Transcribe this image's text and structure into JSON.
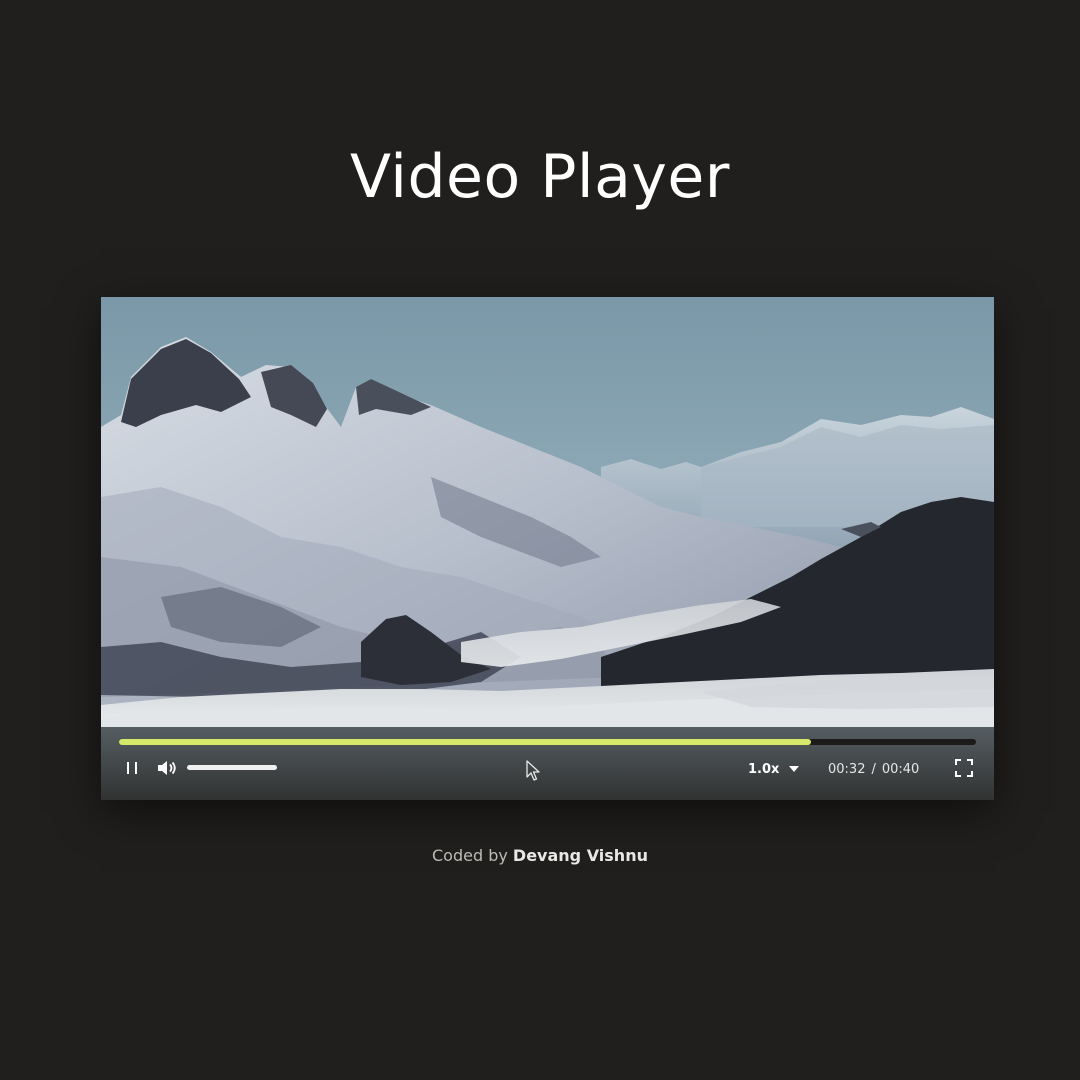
{
  "page": {
    "title": "Video Player",
    "credit_prefix": "Coded by",
    "credit_author": "Devang Vishnu"
  },
  "player": {
    "progress_fraction": 0.807,
    "volume_fraction": 1.0,
    "speed_label": "1.0x",
    "current_time": "00:32",
    "time_separator": "/",
    "duration": "00:40",
    "icons": {
      "play_pause": "pause-icon",
      "volume": "volume-icon",
      "speed_dropdown": "caret-down-icon",
      "fullscreen": "fullscreen-icon",
      "pointer": "mouse-cursor-icon"
    }
  },
  "colors": {
    "background": "#211f1e",
    "progress_accent": "#d6e86a",
    "title_text": "#ffffff"
  }
}
